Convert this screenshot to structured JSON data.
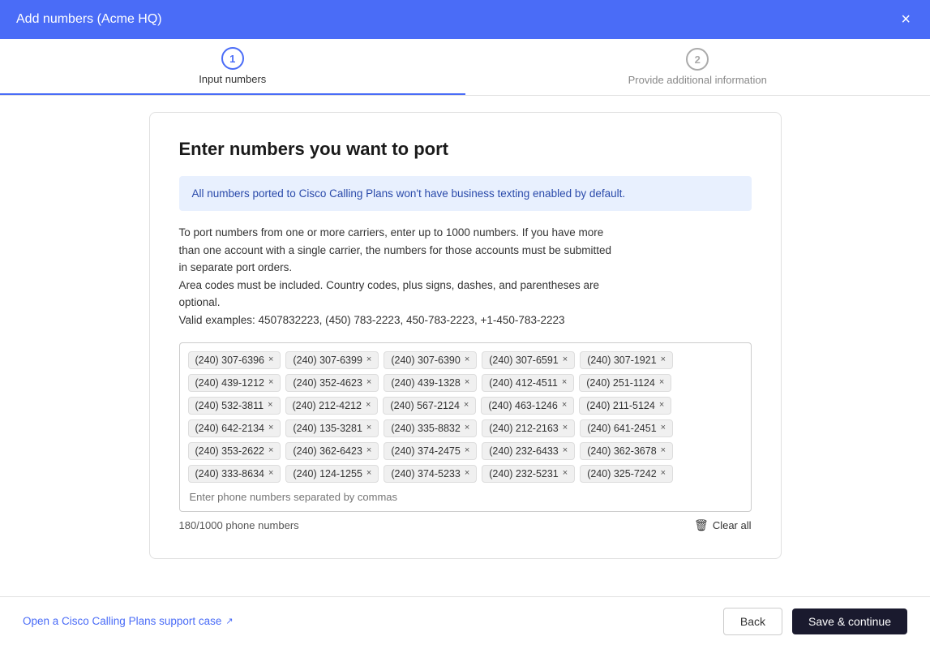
{
  "header": {
    "title": "Add numbers (Acme HQ)",
    "close_label": "×"
  },
  "stepper": {
    "step1": {
      "number": "1",
      "label": "Input numbers",
      "active": true
    },
    "step2": {
      "number": "2",
      "label": "Provide additional information",
      "active": false
    }
  },
  "main": {
    "section_title": "Enter numbers you want to port",
    "info_banner": "All numbers ported to Cisco Calling Plans won't have business texting enabled by default.",
    "description_line1": "To port numbers from one or more carriers, enter up to 1000 numbers. If you have more",
    "description_line2": "than one account with a single carrier, the numbers for those accounts must be submitted",
    "description_line3": "in separate port orders.",
    "description_line4": "Area codes must be included. Country codes, plus signs, dashes, and parentheses are",
    "description_line5": "optional.",
    "description_line6": "Valid examples: 4507832223, (450) 783-2223, 450-783-2223, +1-450-783-2223",
    "tags_row0": [
      {
        "number": "(240) 307-6396",
        "id": "t0_1"
      },
      {
        "number": "(240) 307-6399",
        "id": "t0_2"
      },
      {
        "number": "(240) 307-6390",
        "id": "t0_3"
      },
      {
        "number": "(240) 307-6591",
        "id": "t0_4"
      },
      {
        "number": "(240) 307-1921",
        "id": "t0_5"
      }
    ],
    "tags_row1": [
      {
        "number": "(240) 439-1212",
        "id": "t1_1"
      },
      {
        "number": "(240) 352-4623",
        "id": "t1_2"
      },
      {
        "number": "(240) 439-1328",
        "id": "t1_3"
      },
      {
        "number": "(240) 412-4511",
        "id": "t1_4"
      },
      {
        "number": "(240) 251-1124",
        "id": "t1_5"
      }
    ],
    "tags_row2": [
      {
        "number": "(240) 532-3811",
        "id": "t2_1"
      },
      {
        "number": "(240) 212-4212",
        "id": "t2_2"
      },
      {
        "number": "(240) 567-2124",
        "id": "t2_3"
      },
      {
        "number": "(240) 463-1246",
        "id": "t2_4"
      },
      {
        "number": "(240) 211-5124",
        "id": "t2_5"
      }
    ],
    "tags_row3": [
      {
        "number": "(240) 642-2134",
        "id": "t3_1"
      },
      {
        "number": "(240) 135-3281",
        "id": "t3_2"
      },
      {
        "number": "(240) 335-8832",
        "id": "t3_3"
      },
      {
        "number": "(240) 212-2163",
        "id": "t3_4"
      },
      {
        "number": "(240) 641-2451",
        "id": "t3_5"
      }
    ],
    "tags_row4": [
      {
        "number": "(240) 353-2622",
        "id": "t4_1"
      },
      {
        "number": "(240) 362-6423",
        "id": "t4_2"
      },
      {
        "number": "(240) 374-2475",
        "id": "t4_3"
      },
      {
        "number": "(240) 232-6433",
        "id": "t4_4"
      },
      {
        "number": "(240) 362-3678",
        "id": "t4_5"
      }
    ],
    "tags_row5": [
      {
        "number": "(240) 333-8634",
        "id": "t5_1"
      },
      {
        "number": "(240) 124-1255",
        "id": "t5_2"
      },
      {
        "number": "(240) 374-5233",
        "id": "t5_3"
      },
      {
        "number": "(240) 232-5231",
        "id": "t5_4"
      },
      {
        "number": "(240) 325-7242",
        "id": "t5_5"
      }
    ],
    "input_placeholder": "Enter phone numbers separated by commas",
    "phone_count": "180/1000 phone numbers",
    "clear_all_label": "Clear all"
  },
  "footer": {
    "support_link_label": "Open a Cisco Calling Plans support case",
    "back_label": "Back",
    "continue_label": "Save & continue"
  }
}
